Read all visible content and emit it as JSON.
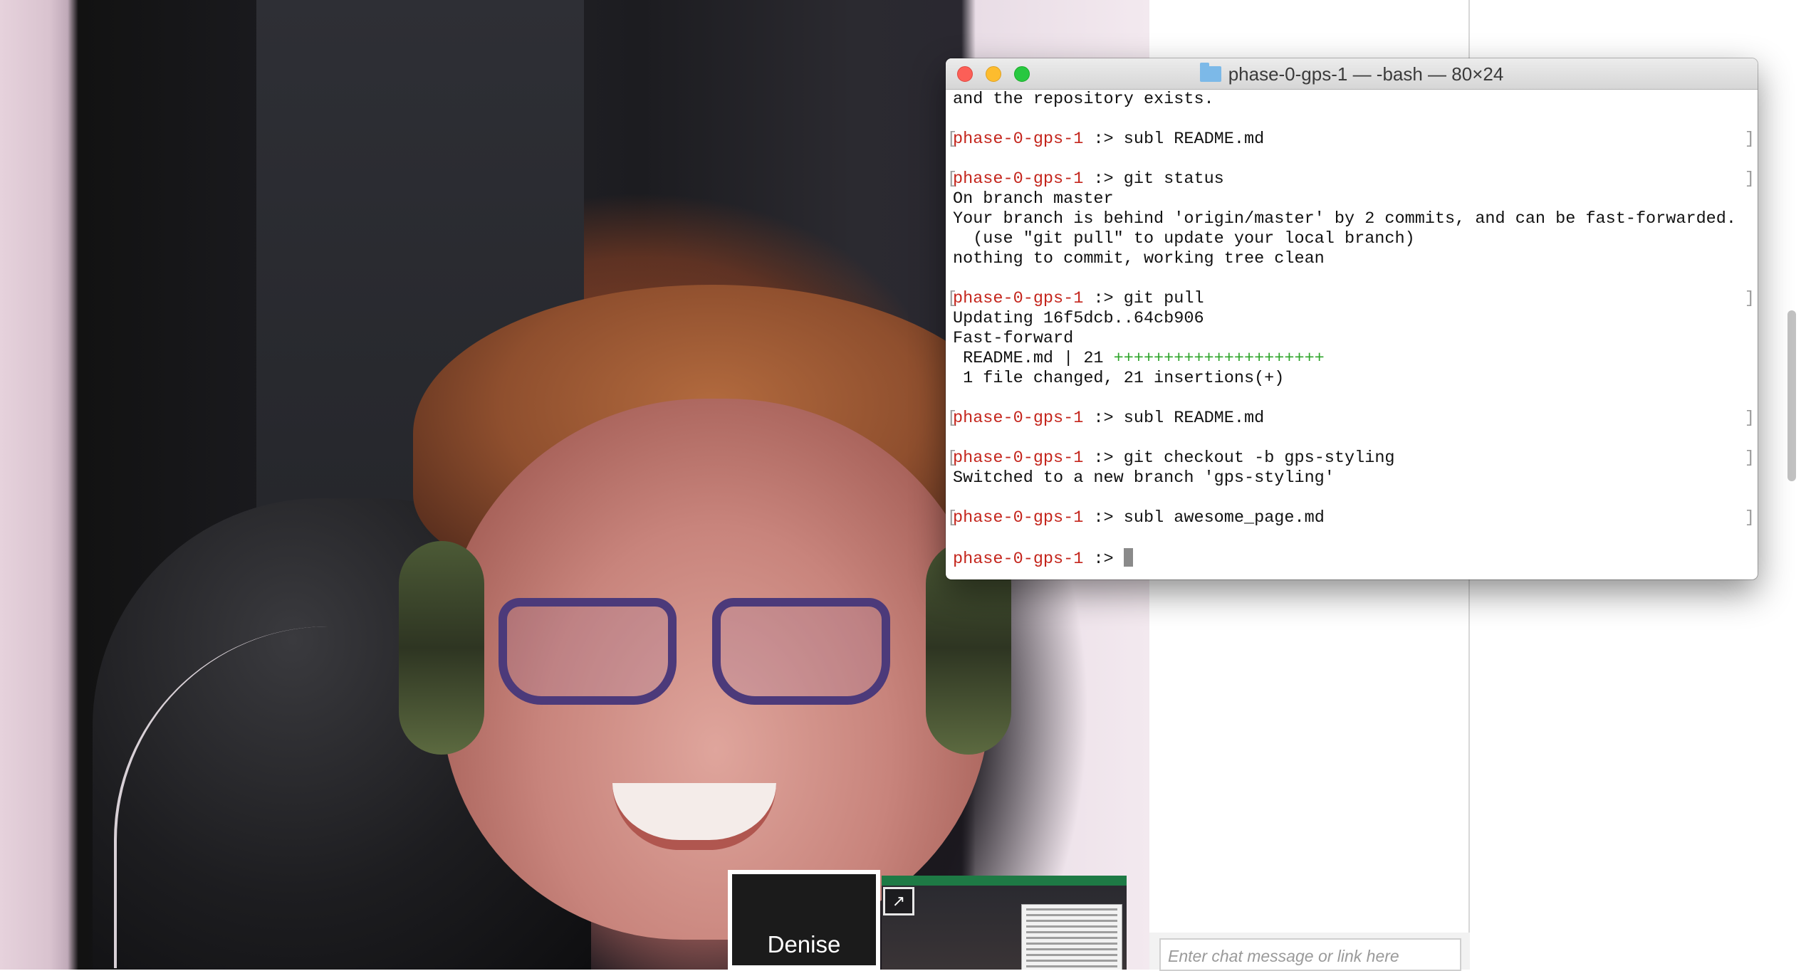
{
  "terminal": {
    "title": "phase-0-gps-1 — -bash — 80×24",
    "prompt": "phase-0-gps-1",
    "prompt_sep": " :> ",
    "lines": {
      "l01": "and the repository exists.",
      "cmd1": "subl README.md",
      "cmd2": "git status",
      "o2a": "On branch master",
      "o2b": "Your branch is behind 'origin/master' by 2 commits, and can be fast-forwarded.",
      "o2c": "  (use \"git pull\" to update your local branch)",
      "o2d": "nothing to commit, working tree clean",
      "cmd3": "git pull",
      "o3a": "Updating 16f5dcb..64cb906",
      "o3b": "Fast-forward",
      "o3c_text": " README.md | 21 ",
      "o3c_plus": "+++++++++++++++++++++",
      "o3d": " 1 file changed, 21 insertions(+)",
      "cmd4": "subl README.md",
      "cmd5": "git checkout -b gps-styling",
      "o5a": "Switched to a new branch 'gps-styling'",
      "cmd6": "subl awesome_page.md"
    }
  },
  "call": {
    "participant_name": "Denise"
  },
  "chat": {
    "input_placeholder": "Enter chat message or link here"
  },
  "colors": {
    "prompt": "#c4251c",
    "diff_plus": "#2fa52b",
    "close": "#fc5f57",
    "minimize": "#fdbc2e",
    "maximize": "#28c840"
  }
}
